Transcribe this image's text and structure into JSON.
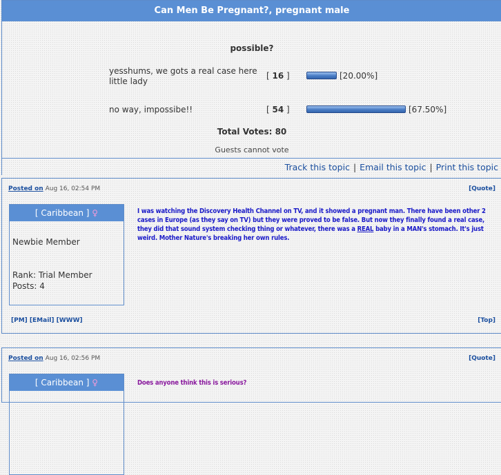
{
  "topic": {
    "title": "Can Men Be Pregnant?, pregnant male"
  },
  "poll": {
    "question": "possible?",
    "options": [
      {
        "text": "yesshums, we gots a real case here little lady",
        "votes": "16",
        "percent": "[20.00%]",
        "fraction": 0.2
      },
      {
        "text": "no way, impossibe!!",
        "votes": "54",
        "percent": "[67.50%]",
        "fraction": 0.675
      }
    ],
    "total_votes": "Total Votes: 80",
    "guests_note": "Guests cannot vote",
    "bracket_open": "[",
    "bracket_close": "]"
  },
  "actions": {
    "track": "Track this topic",
    "email": "Email this topic",
    "print": "Print this topic",
    "separator": "|"
  },
  "posts": [
    {
      "posted_label": "Posted on",
      "posted_date": "Aug 16, 02:54 PM",
      "quote": "[Quote]",
      "user": {
        "name": "[ Caribbean ]",
        "gender_icon": "female-symbol-icon",
        "title": "Newbie Member",
        "rank": "Rank: Trial Member",
        "posts": "Posts: 4"
      },
      "message_color": "#1a1ac8",
      "message_before": "I was watching the Discovery Health Channel on TV, and it showed a pregnant man. There have been other 2 cases in Europe (as they say on TV) but they were proved to be false. But now they finally found a real case, they did that sound system checking thing or whatever, there was a ",
      "message_emph": "REAL",
      "message_after": " baby in a MAN's stomach. It's just weird. Mother Nature's breaking her own rules.",
      "footer_links": "[PM] [EMail] [WWW]",
      "top": "[Top]"
    },
    {
      "posted_label": "Posted on",
      "posted_date": "Aug 16, 02:56 PM",
      "quote": "[Quote]",
      "user": {
        "name": "[ Caribbean ]",
        "gender_icon": "female-symbol-icon"
      },
      "message_color": "#8a1a9e",
      "message": "Does anyone think this is serious?"
    }
  ],
  "colors": {
    "accent": "#5a8fd4",
    "border": "#5d8bc9",
    "link": "#1a4e9e"
  }
}
